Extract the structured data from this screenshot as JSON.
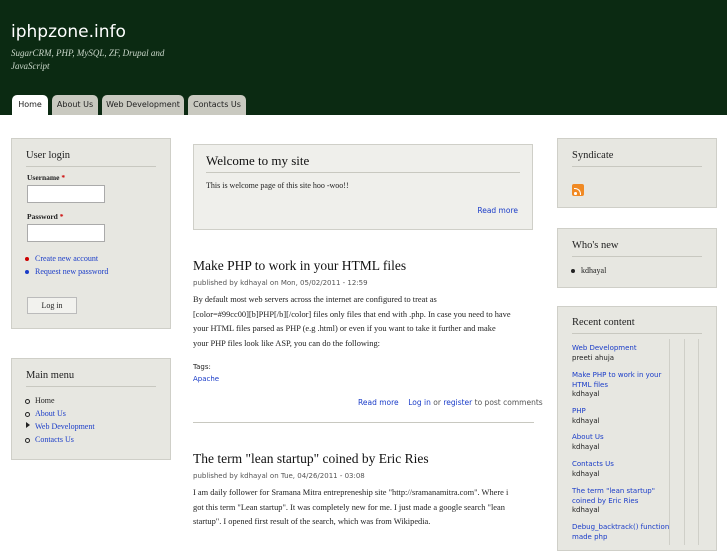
{
  "header": {
    "site_name": "iphpzone.info",
    "slogan": "SugarCRM, PHP, MySQL, ZF, Drupal and JavaScript",
    "tabs": [
      "Home",
      "About Us",
      "Web Development",
      "Contacts Us"
    ]
  },
  "login": {
    "title": "User login",
    "username_label": "Username",
    "password_label": "Password",
    "required_mark": "*",
    "create_account": "Create new account",
    "request_password": "Request new password",
    "login_button": "Log in"
  },
  "main_menu": {
    "title": "Main menu",
    "items": [
      "Home",
      "About Us",
      "Web Development",
      "Contacts Us"
    ]
  },
  "welcome": {
    "title": "Welcome to my site",
    "text": "This is welcome page of this site hoo -woo!!",
    "read_more": "Read more"
  },
  "post1": {
    "title": "Make PHP to work in your HTML files",
    "meta": "published by kdhayal on Mon, 05/02/2011 - 12:59",
    "lines": [
      "By default most web servers across the internet are configured to treat as",
      "[color=#99cc00][b]PHP[/b][/color] files only files that end with .php. In case you need to have",
      "your HTML files parsed as PHP (e.g .html) or even if you want to take it further and make",
      "your PHP files look like ASP, you can do the following:"
    ],
    "tags_label": "Tags:",
    "tag": "Apache",
    "read_more": "Read more",
    "login": "Log in",
    "or": "or",
    "register": "register",
    "post_comments": "to post comments"
  },
  "post2": {
    "title": "The term \"lean startup\" coined by Eric Ries",
    "meta": "published by kdhayal on Tue, 04/26/2011 - 03:08",
    "lines": [
      "I am daily follower for Sramana Mitra entrepreneship site \"http://sramanamitra.com\". Where i",
      "got this term \"Lean startup\". It was completely new for me. I just made a google search \"lean",
      "startup\". I opened first result of the search, which was from Wikipedia."
    ]
  },
  "syndicate": {
    "title": "Syndicate",
    "icon": "rss-feed-icon"
  },
  "whos_new": {
    "title": "Who's new",
    "items": [
      "kdhayal"
    ]
  },
  "recent": {
    "title": "Recent content",
    "items": [
      {
        "title": "Web Development",
        "author": "preeti ahuja"
      },
      {
        "title": "Make PHP to work in your HTML files",
        "author": "kdhayal"
      },
      {
        "title": "PHP",
        "author": "kdhayal"
      },
      {
        "title": "About Us",
        "author": "kdhayal"
      },
      {
        "title": "Contacts Us",
        "author": "kdhayal"
      },
      {
        "title": "The term \"lean startup\" coined by Eric Ries",
        "author": "kdhayal"
      },
      {
        "title": "Debug_backtrack() function made php",
        "author": ""
      }
    ]
  },
  "colors": {
    "header_bg": "#0b2a12",
    "link": "#1a3cc8",
    "block_bg": "#e7e7e1",
    "required": "#cc0000",
    "rss": "#f08a24"
  }
}
